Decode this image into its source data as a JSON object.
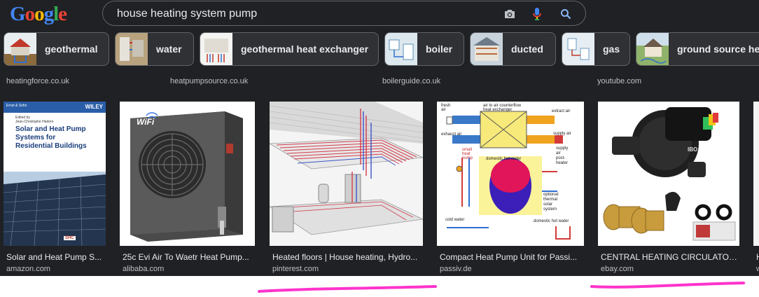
{
  "logo": {
    "text": "Google"
  },
  "search": {
    "query": "house heating system pump"
  },
  "chips": [
    {
      "label": "geothermal"
    },
    {
      "label": "water"
    },
    {
      "label": "geothermal heat exchanger"
    },
    {
      "label": "boiler"
    },
    {
      "label": "ducted"
    },
    {
      "label": "gas"
    },
    {
      "label": "ground source heat pump"
    }
  ],
  "top_sources": [
    "heatingforce.co.uk",
    "heatpumpsource.co.uk",
    "boilerguide.co.uk",
    "youtube.com"
  ],
  "results": [
    {
      "title": "Solar and Heat Pump S...",
      "source": "amazon.com",
      "book": {
        "publisher": "Ernst & Sohn",
        "series": "WILEY",
        "editor": "Edited by\nJean-Christophe Hadorn",
        "title_lines": [
          "Solar and Heat Pump",
          "Systems for",
          "Residential Buildings"
        ],
        "badge": "SHC"
      }
    },
    {
      "title": "25c Evi Air To Waetr Heat Pump...",
      "source": "alibaba.com",
      "label": "WiFi"
    },
    {
      "title": "Heated floors | House heating, Hydro...",
      "source": "pinterest.com"
    },
    {
      "title": "Compact Heat Pump Unit for Passi...",
      "source": "passiv.de",
      "diagram": {
        "fresh_air": "fresh\nair",
        "exchanger": "air to air counterflow\nheat exchanger",
        "extract_air": "extract air",
        "exhaust_air": "exhaust air",
        "supply_air": "supply air",
        "small_pump": "small\nheat\npump",
        "dhw": "domestic hot water",
        "supply_heater": "supply\nair\npost-\nheater",
        "solar": "optional:\nthermal\nsolar\nsystem",
        "cold_water": "cold water",
        "dhw2": "domestic hot water"
      }
    },
    {
      "title": "CENTRAL HEATING CIRCULATOR...",
      "source": "ebay.com",
      "brand": "IBO"
    },
    {
      "title": "H",
      "source": "w"
    }
  ],
  "colors": {
    "background": "#202124",
    "chip_bg": "#303134",
    "border": "#5f6368",
    "text": "#e8eaed",
    "muted": "#bdc1c6",
    "annotation": "#ff33cc"
  }
}
